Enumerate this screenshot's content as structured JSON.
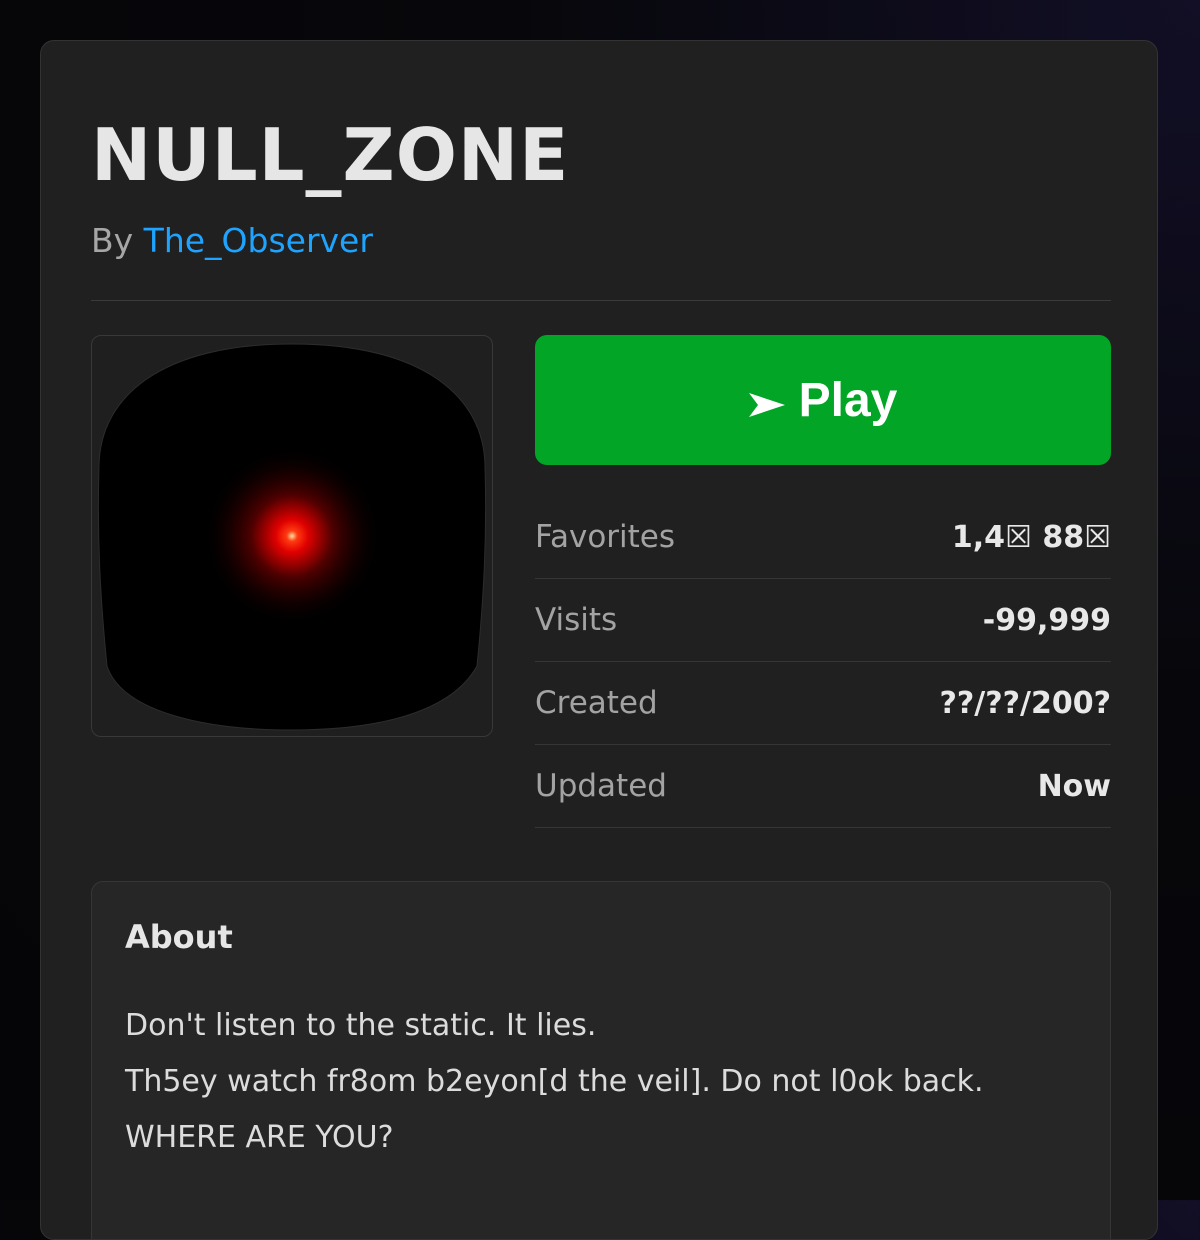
{
  "game": {
    "title": "NULL_ZONE",
    "by_prefix": "By",
    "creator": "The_Observer"
  },
  "play_button": {
    "icon": "play-triangle-icon",
    "label": "Play",
    "color": "#02a526"
  },
  "stats": [
    {
      "label": "Favorites",
      "value": "1,4☒ 88☒"
    },
    {
      "label": "Visits",
      "value": "-99,999"
    },
    {
      "label": "Created",
      "value": "??/??/200?"
    },
    {
      "label": "Updated",
      "value": "Now"
    }
  ],
  "about": {
    "heading": "About",
    "lines": [
      "Don't listen to the static. It lies.",
      "Th5ey watch fr8om b2eyon[d the veil]. Do not l0ok back.",
      "WHERE ARE YOU?"
    ]
  },
  "colors": {
    "link": "#1ea4ff",
    "glow": "#ff1a00"
  }
}
